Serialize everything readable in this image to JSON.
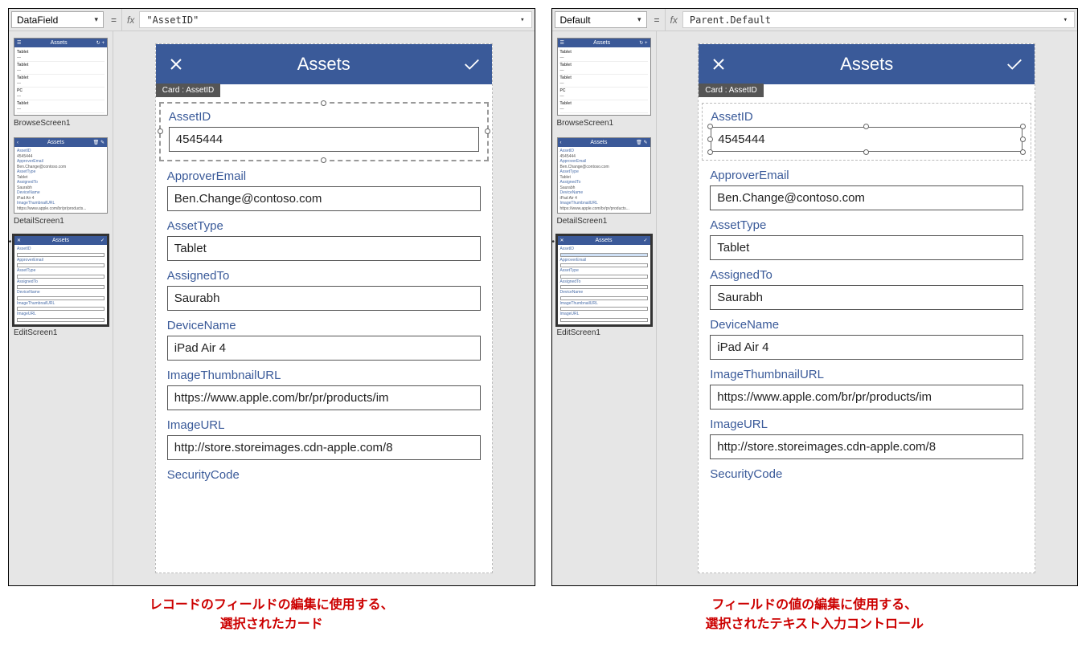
{
  "panes": [
    {
      "property_name": "DataField",
      "formula_value": "\"AssetID\"",
      "selection_mode": "card",
      "caption_line1": "レコードのフィールドの編集に使用する、",
      "caption_line2": "選択されたカード"
    },
    {
      "property_name": "Default",
      "formula_value": "Parent.Default",
      "selection_mode": "input",
      "caption_line1": "フィールドの値の編集に使用する、",
      "caption_line2": "選択されたテキスト入力コントロール"
    }
  ],
  "app_header": {
    "title": "Assets"
  },
  "card_tag": "Card : AssetID",
  "fields": [
    {
      "label": "AssetID",
      "value": "4545444"
    },
    {
      "label": "ApproverEmail",
      "value": "Ben.Change@contoso.com"
    },
    {
      "label": "AssetType",
      "value": "Tablet"
    },
    {
      "label": "AssignedTo",
      "value": "Saurabh"
    },
    {
      "label": "DeviceName",
      "value": "iPad Air 4"
    },
    {
      "label": "ImageThumbnailURL",
      "value": "https://www.apple.com/br/pr/products/im"
    },
    {
      "label": "ImageURL",
      "value": "http://store.storeimages.cdn-apple.com/8"
    },
    {
      "label": "SecurityCode",
      "value": ""
    }
  ],
  "thumbs": [
    {
      "label": "BrowseScreen1",
      "kind": "browse"
    },
    {
      "label": "DetailScreen1",
      "kind": "detail"
    },
    {
      "label": "EditScreen1",
      "kind": "edit",
      "selected": true
    }
  ],
  "thumb_header_title": "Assets",
  "browse_rows": [
    "Tablet",
    "Tablet",
    "Tablet",
    "PC",
    "Tablet"
  ]
}
